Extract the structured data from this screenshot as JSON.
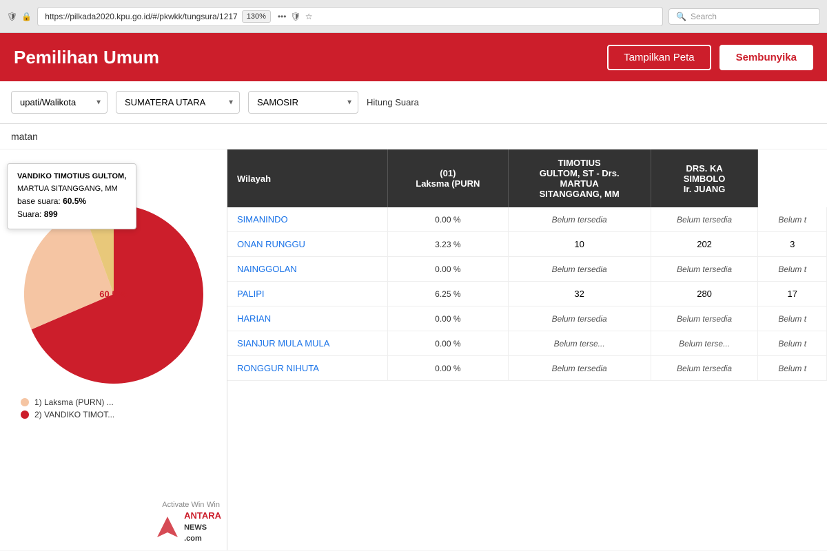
{
  "browser": {
    "url": "https://pilkada2020.kpu.go.id/#/pkwkk/tungsura/1217",
    "zoom": "130%",
    "search_placeholder": "Search"
  },
  "header": {
    "title": "Pemilihan Umum",
    "btn_tampilkan": "Tampilkan Peta",
    "btn_sembunyika": "Sembunyika"
  },
  "filters": {
    "level": "upati/Walikota",
    "provinsi": "SUMATERA UTARA",
    "kabupaten": "SAMOSIR",
    "type": "Hitung Suara"
  },
  "section_label": "matan",
  "table": {
    "headers": [
      "Wilayah",
      "(01)\nLaksma (PURN",
      "TIMOTIUS\nGULTOM, ST - Drs.\nMARTUA\nSITANGGANG, MM",
      "DRS. KA\nSIMBOLO\nIr. JUANG"
    ],
    "rows": [
      {
        "wilayah": "SIMANINDO",
        "pct": "0.00 %",
        "col1": "Belum tersedia",
        "col2": "Belum tersedia",
        "col3": "Belum t"
      },
      {
        "wilayah": "ONAN RUNGGU",
        "pct": "3.23 %",
        "col1": "10",
        "col2": "202",
        "col3": "3"
      },
      {
        "wilayah": "NAINGGOLAN",
        "pct": "0.00 %",
        "col1": "Belum tersedia",
        "col2": "Belum tersedia",
        "col3": "Belum t"
      },
      {
        "wilayah": "PALIPI",
        "pct": "6.25 %",
        "col1": "32",
        "col2": "280",
        "col3": "17"
      },
      {
        "wilayah": "HARIAN",
        "pct": "0.00 %",
        "col1": "Belum tersedia",
        "col2": "Belum tersedia",
        "col3": "Belum t"
      },
      {
        "wilayah": "SIANJUR MULA MULA",
        "pct": "0.00 %",
        "col1": "Belum terse...",
        "col2": "Belum terse...",
        "col3": "Belum t"
      },
      {
        "wilayah": "RONGGUR NIHUTA",
        "pct": "0.00 %",
        "col1": "Belum tersedia",
        "col2": "Belum tersedia",
        "col3": "Belum t"
      }
    ]
  },
  "tooltip": {
    "title": "VANDIKO TIMOTIUS GULTOM,",
    "subtitle": "MARTUA SITANGGANG, MM",
    "base_label": "base suara:",
    "base_value": "60.5%",
    "suara_label": "Suara:",
    "suara_value": "899",
    "center_label": "60.5 %"
  },
  "legend": [
    {
      "label": "1) Laksma (PURN) ...",
      "color": "#f5c5a3"
    },
    {
      "label": "2) VANDIKO TIMOT...",
      "color": "#cc1e2b"
    }
  ],
  "pie": {
    "segments": [
      {
        "percent": 60.5,
        "color": "#cc1e2b",
        "startAngle": 0
      },
      {
        "percent": 35,
        "color": "#f5c5a3",
        "startAngle": 217.8
      },
      {
        "percent": 4.5,
        "color": "#e8c87a",
        "startAngle": 343.8
      }
    ]
  },
  "watermark": {
    "activate": "Activate Win",
    "brand": "ANTARA",
    "domain": "NEWS\n.com"
  }
}
